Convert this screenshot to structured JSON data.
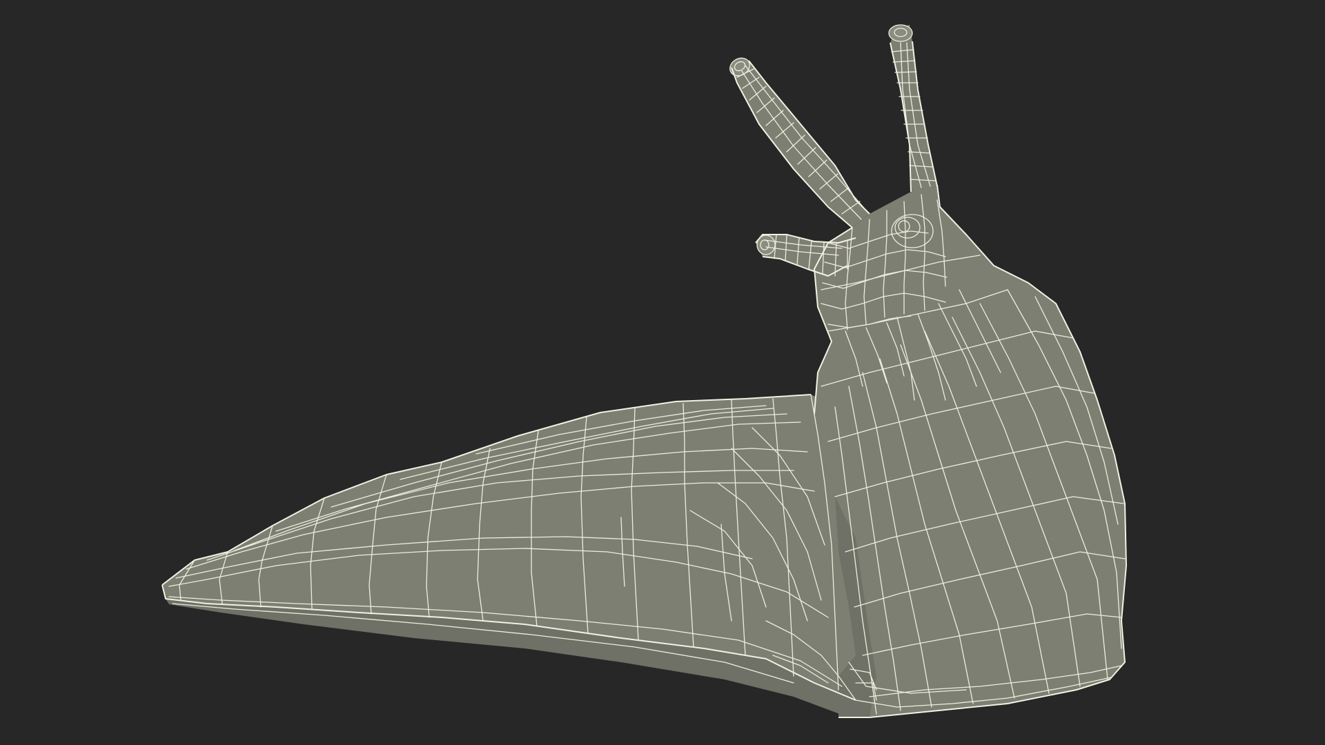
{
  "viewport": {
    "background_color": "#272727",
    "model_fill_color": "#7d7f72",
    "wireframe_color": "#eeeede"
  },
  "scene": {
    "subject": "slug-wireframe-model",
    "render_mode": "wireframe-on-shaded"
  }
}
